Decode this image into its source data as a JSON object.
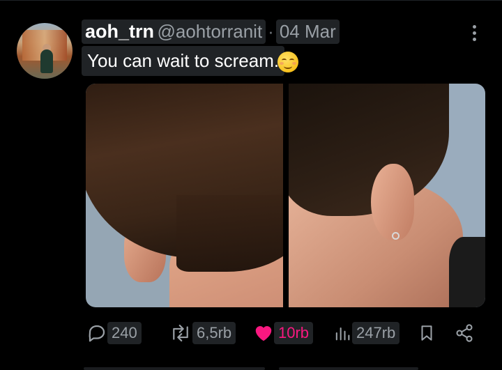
{
  "post": {
    "author_name": "aoh_trn",
    "author_handle": "@aohtorranit",
    "separator": "·",
    "date": "04 Mar",
    "text": "You can wait to scream.",
    "emoji": "smiling-face-with-blush-emoji"
  },
  "actions": {
    "replies": "240",
    "reposts": "6,5rb",
    "likes": "10rb",
    "views": "247rb"
  },
  "colors": {
    "background": "#000000",
    "like_accent": "#f91880",
    "muted_text": "#9aa0a6"
  }
}
